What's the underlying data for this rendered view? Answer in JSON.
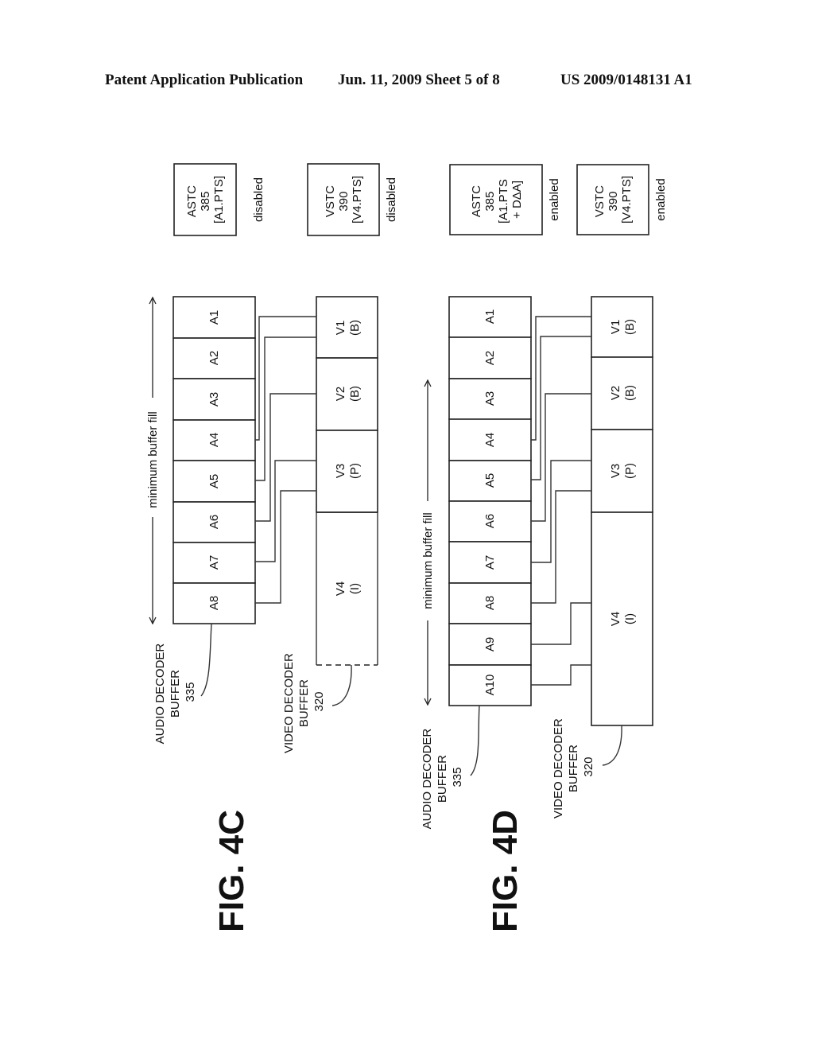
{
  "header": {
    "left": "Patent Application Publication",
    "center": "Jun. 11, 2009  Sheet 5 of 8",
    "right": "US 2009/0148131 A1"
  },
  "figures": [
    {
      "id": "fig4c",
      "title": "FIG. 4C",
      "stc": [
        {
          "lines": [
            "ASTC",
            "385",
            "[A1.PTS]"
          ],
          "state": "disabled"
        },
        {
          "lines": [
            "VSTC",
            "390",
            "[V4.PTS]"
          ],
          "state": "disabled"
        }
      ],
      "min_fill_label": "minimum buffer fill",
      "audio_buffer": {
        "label_lines": [
          "AUDIO DECODER",
          "BUFFER",
          "335"
        ],
        "cells": [
          "A1",
          "A2",
          "A3",
          "A4",
          "A5",
          "A6",
          "A7",
          "A8"
        ]
      },
      "video_buffer": {
        "label_lines": [
          "VIDEO DECODER",
          "BUFFER",
          "320"
        ],
        "cells": [
          [
            "V1",
            "(B)"
          ],
          [
            "V2",
            "(B)"
          ],
          [
            "V3",
            "(P)"
          ],
          [
            "V4",
            "(I)"
          ]
        ]
      }
    },
    {
      "id": "fig4d",
      "title": "FIG. 4D",
      "stc": [
        {
          "lines": [
            "ASTC",
            "385",
            "[A1.PTS",
            "+ DΔA]"
          ],
          "state": "enabled"
        },
        {
          "lines": [
            "VSTC",
            "390",
            "[V4.PTS]"
          ],
          "state": "enabled"
        }
      ],
      "min_fill_label": "minimum buffer fill",
      "audio_buffer": {
        "label_lines": [
          "AUDIO DECODER",
          "BUFFER",
          "335"
        ],
        "cells": [
          "A1",
          "A2",
          "A3",
          "A4",
          "A5",
          "A6",
          "A7",
          "A8",
          "A9",
          "A10"
        ]
      },
      "video_buffer": {
        "label_lines": [
          "VIDEO DECODER",
          "BUFFER",
          "320"
        ],
        "cells": [
          [
            "V1",
            "(B)"
          ],
          [
            "V2",
            "(B)"
          ],
          [
            "V3",
            "(P)"
          ],
          [
            "V4",
            "(I)"
          ]
        ]
      }
    }
  ]
}
